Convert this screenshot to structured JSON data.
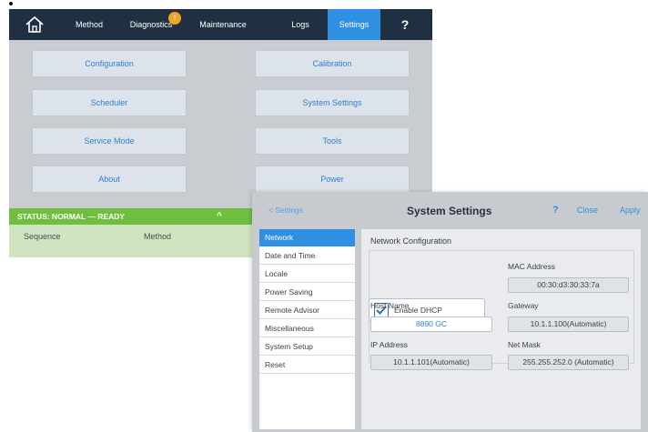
{
  "topbar": {
    "tabs": [
      {
        "label": "Method"
      },
      {
        "label": "Diagnostics",
        "badge": "!"
      },
      {
        "label": "Maintenance"
      },
      {
        "label": "Logs"
      },
      {
        "label": "Settings",
        "active": true
      },
      {
        "label": "?"
      }
    ]
  },
  "menu": {
    "buttons": [
      "Configuration",
      "Calibration",
      "Scheduler",
      "System Settings",
      "Service Mode",
      "Tools",
      "About",
      "Power"
    ]
  },
  "status": {
    "text": "STATUS: NORMAL — READY",
    "chevron": "^",
    "columns": [
      "Sequence",
      "Method"
    ]
  },
  "dialog": {
    "back": "< Settings",
    "title": "System Settings",
    "help": "?",
    "close": "Close",
    "apply": "Apply",
    "nav": [
      "Network",
      "Date and Time",
      "Locale",
      "Power Saving",
      "Remote Advisor",
      "Miscellaneous",
      "System Setup",
      "Reset"
    ],
    "network": {
      "section_title": "Network Configuration",
      "enable_dhcp": "Enable DHCP",
      "enable_dhcp_checked": true,
      "mac_label": "MAC Address",
      "mac_value": "00:30:d3:30:33:7a",
      "host_label": "Host Name",
      "host_value": "8890 GC",
      "gateway_label": "Gateway",
      "gateway_value": "10.1.1.100(Automatic)",
      "ip_label": "IP Address",
      "ip_value": "10.1.1.101(Automatic)",
      "mask_label": "Net Mask",
      "mask_value": "255.255.252.0 (Automatic)"
    }
  },
  "colors": {
    "topbar": "#1f3043",
    "accent": "#2f8fe0",
    "status_green": "#6fbe3d",
    "badge": "#f0a623"
  }
}
